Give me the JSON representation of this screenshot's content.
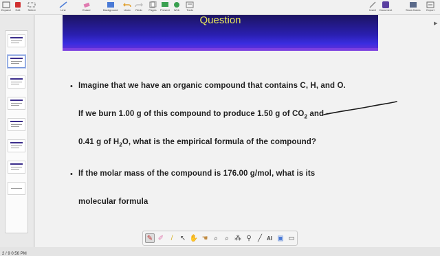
{
  "toolbar": {
    "buttons": [
      {
        "label": "Expand",
        "icon": "expand-icon",
        "color": "#5b5b5b"
      },
      {
        "label": "Edit",
        "icon": "edit-icon",
        "color": "#d03030"
      },
      {
        "label": "Select",
        "icon": "select-icon",
        "color": "#555555"
      },
      {
        "label": "Line",
        "icon": "line-icon",
        "color": "#4a7ad6"
      },
      {
        "label": "Eraser",
        "icon": "eraser-icon",
        "color": "#e07ab0"
      },
      {
        "label": "Background",
        "icon": "background-icon",
        "color": "#4a7ad6"
      },
      {
        "label": "Undo",
        "icon": "undo-icon",
        "color": "#e0a030"
      },
      {
        "label": "Redo",
        "icon": "redo-icon",
        "color": "#c0c0c0"
      },
      {
        "label": "Pages",
        "icon": "pages-icon",
        "color": "#777777"
      },
      {
        "label": "Present",
        "icon": "present-icon",
        "color": "#3aa050"
      },
      {
        "label": "Web",
        "icon": "web-icon",
        "color": "#3aa050"
      },
      {
        "label": "Tools",
        "icon": "tools-icon",
        "color": "#777777"
      }
    ],
    "right_buttons": [
      {
        "label": "Insert",
        "icon": "insert-icon",
        "color": "#888888"
      },
      {
        "label": "Document",
        "icon": "document-icon",
        "color": "#5a3fa0"
      },
      {
        "label": "Show Notes",
        "icon": "notes-icon",
        "color": "#5a6a8a"
      },
      {
        "label": "Export",
        "icon": "export-icon",
        "color": "#6a6a6a"
      }
    ]
  },
  "slide_panel": {
    "page_indicator": "2 / 9  0:56 PM",
    "thumbnail_count": 8,
    "active_index": 1
  },
  "slide": {
    "title": "Question",
    "title_color": "#e8e85a",
    "banner_color": "#2a1fb0",
    "bullet_char": "•",
    "lines": {
      "l1": "Imagine that we have an organic compound that contains C, H, and O.",
      "l2_pre": "If we burn 1.00 g of this compound to produce 1.50 g of CO",
      "l2_sub": "2",
      "l2_post": " and",
      "l3_pre": "0.41 g of H",
      "l3_sub": "2",
      "l3_post": "O, what is the empirical formula of the compound?",
      "l4": "If the molar mass of the compound is 176.00 g/mol, what is its",
      "l5": "molecular formula"
    }
  },
  "bottom_toolbar": {
    "tools": [
      {
        "name": "pen-tool",
        "glyph": "✎",
        "active": true
      },
      {
        "name": "highlighter-tool",
        "glyph": "✐"
      },
      {
        "name": "marker-tool",
        "glyph": "/"
      },
      {
        "name": "pointer-tool",
        "glyph": "↖"
      },
      {
        "name": "hand-tool",
        "glyph": "✋"
      },
      {
        "name": "hand-alt-tool",
        "glyph": "☚"
      },
      {
        "name": "zoom-tool",
        "glyph": "⌕"
      },
      {
        "name": "zoom-alt-tool",
        "glyph": "⌕"
      },
      {
        "name": "magic-wand-tool",
        "glyph": "⁂"
      },
      {
        "name": "spotlight-tool",
        "glyph": "⚲"
      },
      {
        "name": "line-tool",
        "glyph": "╱"
      },
      {
        "name": "text-tool",
        "glyph": "AI"
      },
      {
        "name": "screenshot-tool",
        "glyph": "▣"
      },
      {
        "name": "keyboard-tool",
        "glyph": "▭"
      }
    ]
  }
}
